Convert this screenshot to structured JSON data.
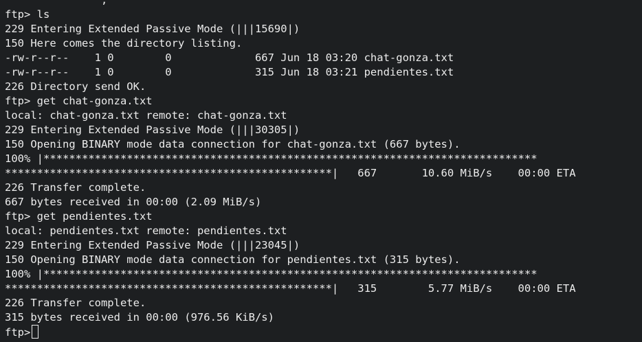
{
  "terminal": {
    "lines": [
      "               ,",
      "ftp> ls",
      "229 Entering Extended Passive Mode (|||15690|)",
      "150 Here comes the directory listing.",
      "-rw-r--r--    1 0        0             667 Jun 18 03:20 chat-gonza.txt",
      "-rw-r--r--    1 0        0             315 Jun 18 03:21 pendientes.txt",
      "226 Directory send OK.",
      "ftp> get chat-gonza.txt",
      "local: chat-gonza.txt remote: chat-gonza.txt",
      "229 Entering Extended Passive Mode (|||30305|)",
      "150 Opening BINARY mode data connection for chat-gonza.txt (667 bytes).",
      "100% |*****************************************************************************",
      "***************************************************|   667       10.60 MiB/s    00:00 ETA",
      "226 Transfer complete.",
      "667 bytes received in 00:00 (2.09 MiB/s)",
      "ftp> get pendientes.txt",
      "local: pendientes.txt remote: pendientes.txt",
      "229 Entering Extended Passive Mode (|||23045|)",
      "150 Opening BINARY mode data connection for pendientes.txt (315 bytes).",
      "100% |*****************************************************************************",
      "***************************************************|   315        5.77 MiB/s    00:00 ETA",
      "226 Transfer complete.",
      "315 bytes received in 00:00 (976.56 KiB/s)"
    ],
    "prompt": "ftp>"
  },
  "colors": {
    "background": "#1d1f21",
    "foreground": "#ececec"
  }
}
